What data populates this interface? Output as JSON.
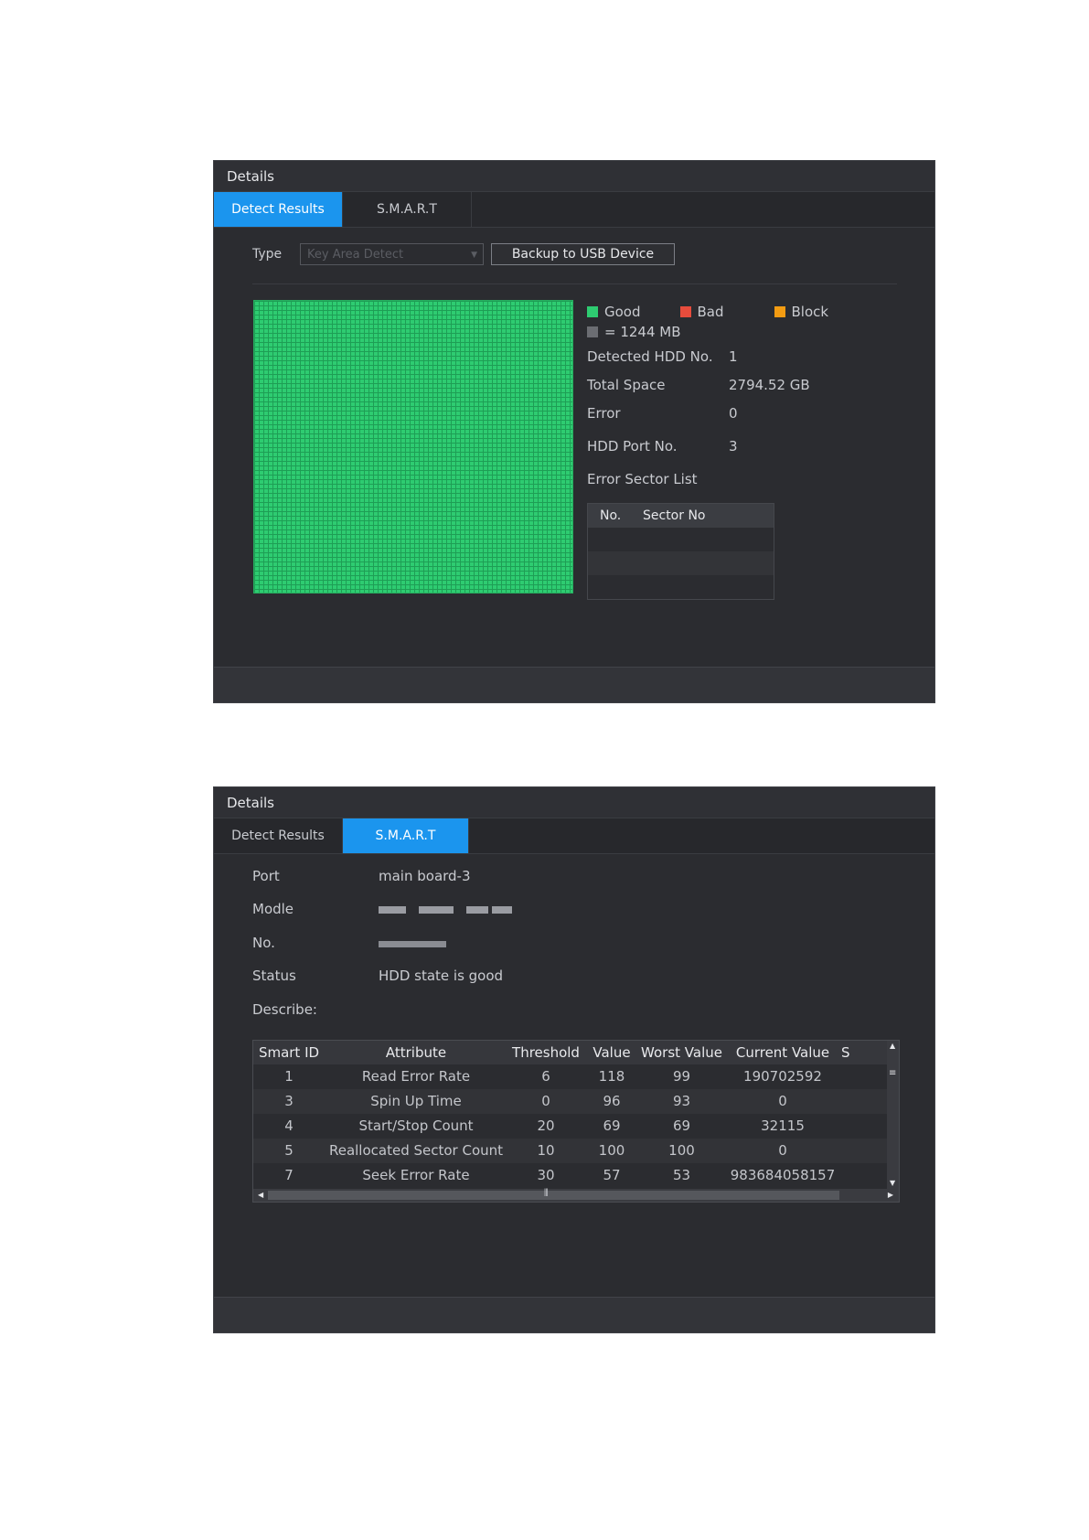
{
  "panel1": {
    "title": "Details",
    "tabs": [
      {
        "label": "Detect Results",
        "active": true
      },
      {
        "label": "S.M.A.R.T",
        "active": false
      }
    ],
    "type_label": "Type",
    "type_value": "Key Area Detect",
    "backup_button": "Backup to USB Device",
    "legend": {
      "good": "Good",
      "bad": "Bad",
      "block": "Block",
      "unit": "= 1244 MB"
    },
    "colors": {
      "good": "#2ecc71",
      "bad": "#e74c3c",
      "block": "#f39c12",
      "unit": "#6b6d72",
      "accent": "#1b95ee"
    },
    "info": [
      {
        "key": "Detected HDD No.",
        "value": "1"
      },
      {
        "key": "Total Space",
        "value": "2794.52 GB"
      },
      {
        "key": "Error",
        "value": "0"
      },
      {
        "key": "HDD Port No.",
        "value": "3"
      }
    ],
    "error_list_label": "Error Sector List",
    "error_table": {
      "col_no": "No.",
      "col_sector": "Sector No"
    }
  },
  "panel2": {
    "title": "Details",
    "tabs": [
      {
        "label": "Detect Results",
        "active": false
      },
      {
        "label": "S.M.A.R.T",
        "active": true
      }
    ],
    "port_label": "Port",
    "port_value": "main board-3",
    "model_label": "Modle",
    "no_label": "No.",
    "status_label": "Status",
    "status_value": "HDD state is good",
    "describe_label": "Describe:",
    "table_headers": [
      "Smart ID",
      "Attribute",
      "Threshold",
      "Value",
      "Worst Value",
      "Current Value",
      "S"
    ],
    "rows": [
      [
        "1",
        "Read Error Rate",
        "6",
        "118",
        "99",
        "190702592"
      ],
      [
        "3",
        "Spin Up Time",
        "0",
        "96",
        "93",
        "0"
      ],
      [
        "4",
        "Start/Stop Count",
        "20",
        "69",
        "69",
        "32115"
      ],
      [
        "5",
        "Reallocated Sector Count",
        "10",
        "100",
        "100",
        "0"
      ],
      [
        "7",
        "Seek Error Rate",
        "30",
        "57",
        "53",
        "983684058157"
      ]
    ]
  }
}
